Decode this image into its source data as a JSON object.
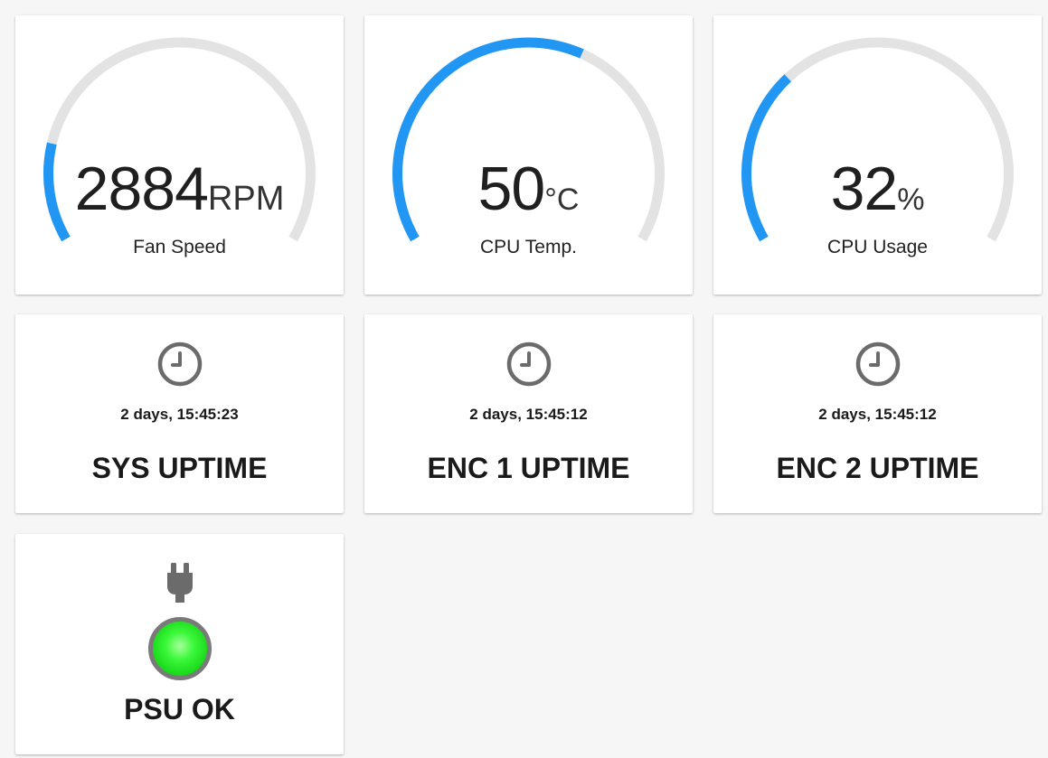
{
  "colors": {
    "accent": "#2196f3",
    "track": "#e3e3e3",
    "icon": "#6b6b6b",
    "led_ok": "#2ef02a"
  },
  "gauges": [
    {
      "value": "2884",
      "unit": "RPM",
      "label": "Fan Speed",
      "fraction": 0.18
    },
    {
      "value": "50",
      "unit": "°C",
      "label": "CPU Temp.",
      "fraction": 0.6
    },
    {
      "value": "32",
      "unit": "%",
      "label": "CPU Usage",
      "fraction": 0.32
    }
  ],
  "uptimes": [
    {
      "icon": "clock-icon",
      "time": "2 days, 15:45:23",
      "title": "SYS UPTIME"
    },
    {
      "icon": "clock-icon",
      "time": "2 days, 15:45:12",
      "title": "ENC 1 UPTIME"
    },
    {
      "icon": "clock-icon",
      "time": "2 days, 15:45:12",
      "title": "ENC 2 UPTIME"
    }
  ],
  "psu": {
    "icon": "plug-icon",
    "status_icon": "led-indicator",
    "title": "PSU OK"
  }
}
